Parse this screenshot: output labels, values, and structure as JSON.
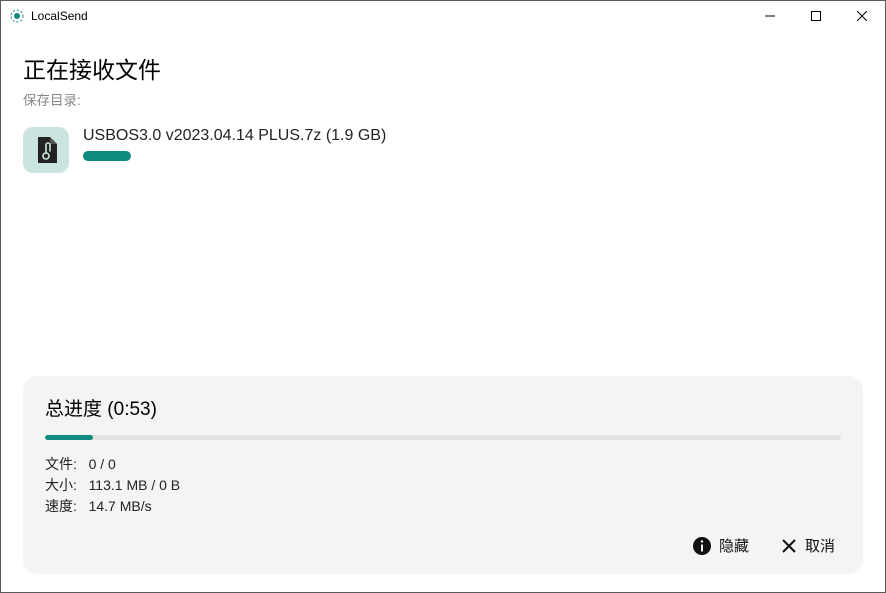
{
  "window": {
    "title": "LocalSend"
  },
  "header": {
    "heading": "正在接收文件",
    "save_dir_label": "保存目录:"
  },
  "file": {
    "name": "USBOS3.0 v2023.04.14 PLUS.7z (1.9 GB)"
  },
  "summary": {
    "title_prefix": "总进度",
    "time": "(0:53)",
    "stats": {
      "files_label": "文件:",
      "files_value": "0 / 0",
      "size_label": "大小:",
      "size_value": "113.1 MB / 0 B",
      "speed_label": "速度:",
      "speed_value": "14.7 MB/s"
    }
  },
  "actions": {
    "hide": "隐藏",
    "cancel": "取消"
  }
}
